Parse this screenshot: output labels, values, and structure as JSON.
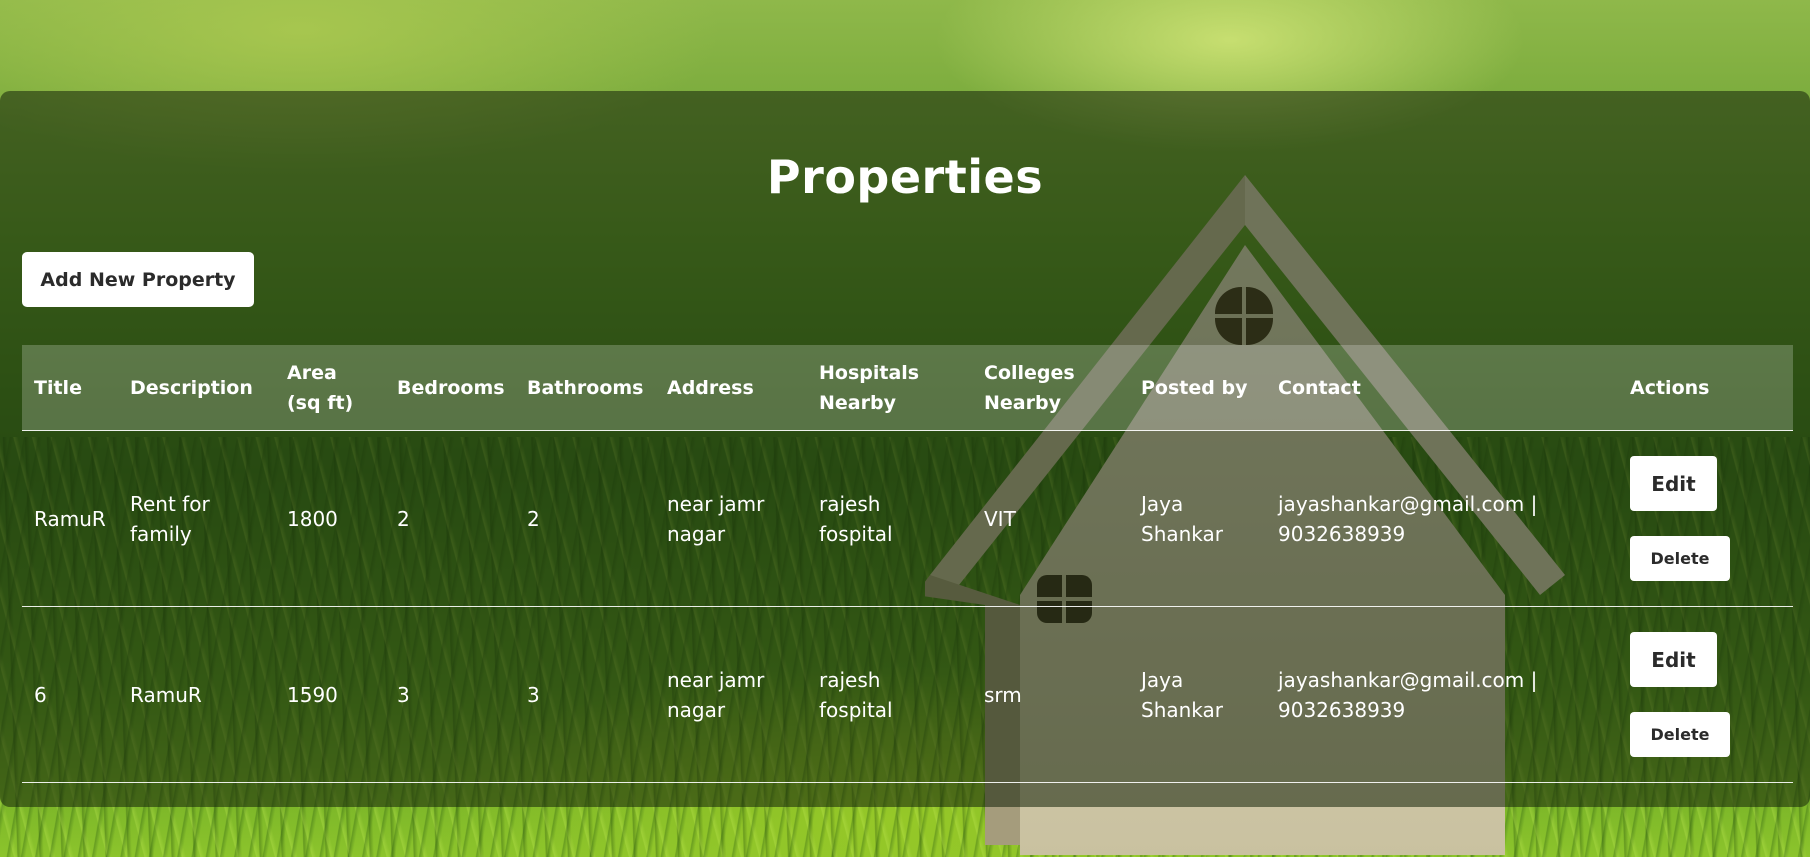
{
  "page": {
    "title": "Properties",
    "add_button_label": "Add New Property"
  },
  "table": {
    "headers": {
      "title": "Title",
      "description": "Description",
      "area": "Area (sq ft)",
      "bedrooms": "Bedrooms",
      "bathrooms": "Bathrooms",
      "address": "Address",
      "hospitals": "Hospitals Nearby",
      "colleges": "Colleges Nearby",
      "posted_by": "Posted by",
      "contact": "Contact",
      "actions": "Actions"
    },
    "rows": [
      {
        "title": "RamuR",
        "description": "Rent for family",
        "area": "1800",
        "bedrooms": "2",
        "bathrooms": "2",
        "address": "near jamr nagar",
        "hospitals": "rajesh fospital",
        "colleges": "VIT",
        "posted_by": "Jaya Shankar",
        "contact": "jayashankar@gmail.com | 9032638939",
        "edit_label": "Edit",
        "delete_label": "Delete"
      },
      {
        "title": "6",
        "description": "RamuR",
        "area": "1590",
        "bedrooms": "3",
        "bathrooms": "3",
        "address": "near jamr nagar",
        "hospitals": "rajesh fospital",
        "colleges": "srm",
        "posted_by": "Jaya Shankar",
        "contact": "jayashankar@gmail.com | 9032638939",
        "edit_label": "Edit",
        "delete_label": "Delete"
      }
    ]
  },
  "background": {
    "image": "house-on-grass-photo"
  },
  "colors": {
    "panel_overlay": "#14230a",
    "text": "#ffffff",
    "button_bg": "#ffffff",
    "button_text": "#2b2b2b"
  }
}
